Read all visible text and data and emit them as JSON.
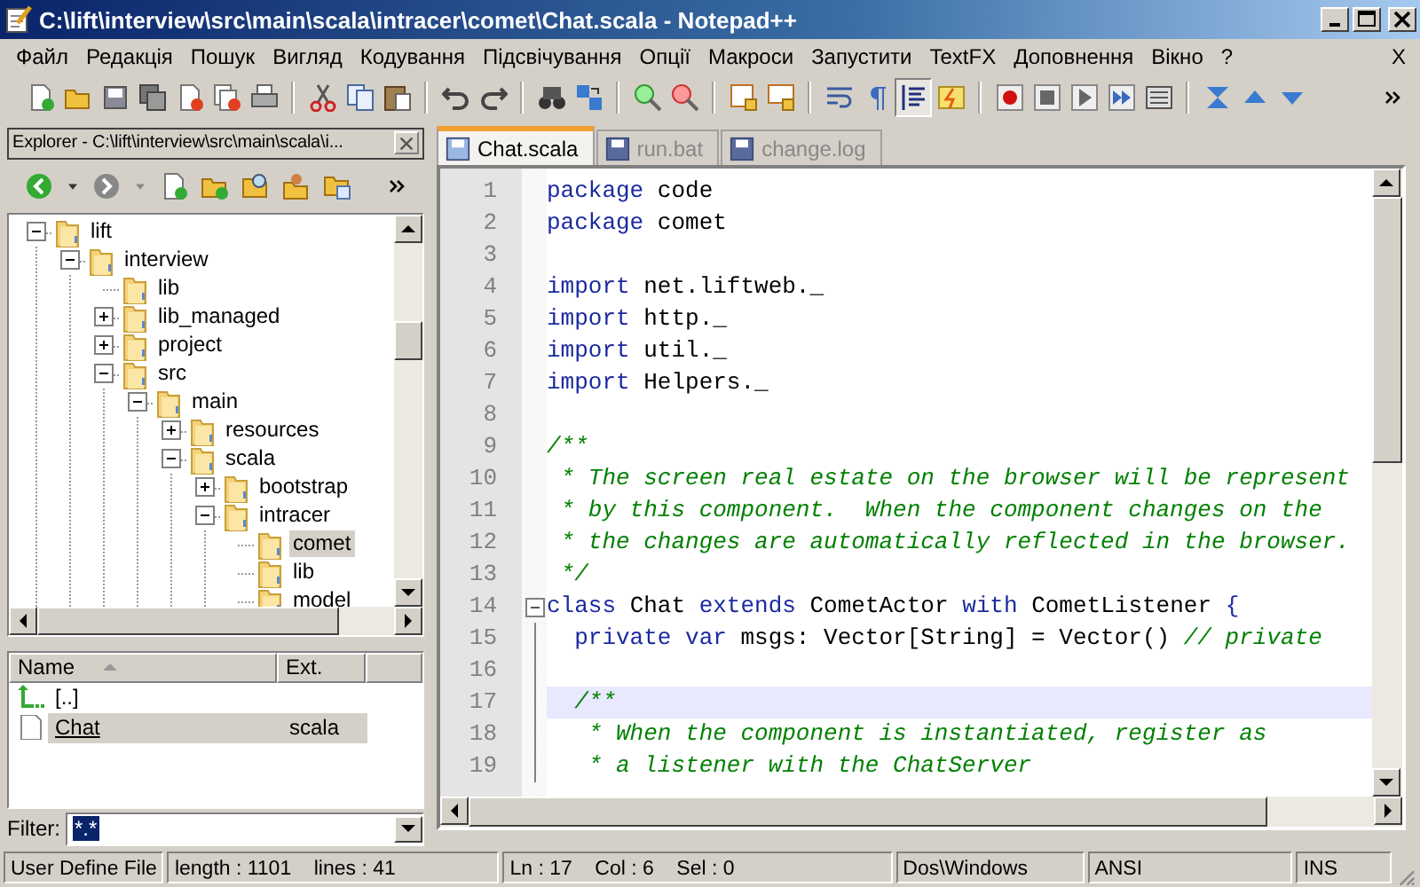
{
  "window": {
    "title": "C:\\lift\\interview\\src\\main\\scala\\intracer\\comet\\Chat.scala - Notepad++"
  },
  "menu": {
    "items": [
      "Файл",
      "Редакція",
      "Пошук",
      "Вигляд",
      "Кодування",
      "Підсвічування",
      "Опції",
      "Макроси",
      "Запустити",
      "TextFX",
      "Доповнення",
      "Вікно",
      "?"
    ],
    "close_doc": "X"
  },
  "toolbar": [
    {
      "kind": "new",
      "pressed": false
    },
    {
      "kind": "open",
      "pressed": false
    },
    {
      "kind": "save",
      "pressed": false
    },
    {
      "kind": "save_all",
      "pressed": false
    },
    {
      "kind": "close",
      "pressed": false
    },
    {
      "kind": "close_all",
      "pressed": false
    },
    {
      "kind": "print",
      "pressed": false
    },
    {
      "kind": "separator"
    },
    {
      "kind": "cut",
      "pressed": false
    },
    {
      "kind": "copy",
      "pressed": false
    },
    {
      "kind": "paste",
      "pressed": false
    },
    {
      "kind": "separator"
    },
    {
      "kind": "undo",
      "pressed": false
    },
    {
      "kind": "redo",
      "pressed": false
    },
    {
      "kind": "separator"
    },
    {
      "kind": "find",
      "pressed": false
    },
    {
      "kind": "replace",
      "pressed": false
    },
    {
      "kind": "separator"
    },
    {
      "kind": "zoom_in",
      "pressed": false
    },
    {
      "kind": "zoom_out",
      "pressed": false
    },
    {
      "kind": "separator"
    },
    {
      "kind": "sync_v",
      "pressed": false
    },
    {
      "kind": "sync_h",
      "pressed": false
    },
    {
      "kind": "separator"
    },
    {
      "kind": "wrap",
      "pressed": false
    },
    {
      "kind": "all_chars",
      "pressed": false
    },
    {
      "kind": "indent_guide",
      "pressed": true
    },
    {
      "kind": "user_lang",
      "pressed": false
    },
    {
      "kind": "separator"
    },
    {
      "kind": "record",
      "pressed": false
    },
    {
      "kind": "stop",
      "pressed": false
    },
    {
      "kind": "play",
      "pressed": false
    },
    {
      "kind": "play_multi",
      "pressed": false
    },
    {
      "kind": "save_macro",
      "pressed": false
    },
    {
      "kind": "separator"
    },
    {
      "kind": "fold",
      "pressed": false
    },
    {
      "kind": "up",
      "pressed": false
    },
    {
      "kind": "down",
      "pressed": false
    }
  ],
  "explorer": {
    "title": "Explorer - C:\\lift\\interview\\src\\main\\scala\\i...",
    "tree": [
      {
        "label": "lift",
        "has_children": true,
        "expanded": true,
        "selected": false,
        "children": [
          {
            "label": "interview",
            "has_children": true,
            "expanded": true,
            "selected": false,
            "children": [
              {
                "label": "lib",
                "has_children": false,
                "expanded": false,
                "selected": false
              },
              {
                "label": "lib_managed",
                "has_children": true,
                "expanded": false,
                "selected": false
              },
              {
                "label": "project",
                "has_children": true,
                "expanded": false,
                "selected": false
              },
              {
                "label": "src",
                "has_children": true,
                "expanded": true,
                "selected": false,
                "children": [
                  {
                    "label": "main",
                    "has_children": true,
                    "expanded": true,
                    "selected": false,
                    "children": [
                      {
                        "label": "resources",
                        "has_children": true,
                        "expanded": false,
                        "selected": false
                      },
                      {
                        "label": "scala",
                        "has_children": true,
                        "expanded": true,
                        "selected": false,
                        "children": [
                          {
                            "label": "bootstrap",
                            "has_children": true,
                            "expanded": false,
                            "selected": false
                          },
                          {
                            "label": "intracer",
                            "has_children": true,
                            "expanded": true,
                            "selected": false,
                            "children": [
                              {
                                "label": "comet",
                                "has_children": false,
                                "expanded": false,
                                "selected": true
                              },
                              {
                                "label": "lib",
                                "has_children": false,
                                "expanded": false,
                                "selected": false
                              },
                              {
                                "label": "model",
                                "has_children": false,
                                "expanded": false,
                                "selected": false
                              }
                            ]
                          }
                        ]
                      }
                    ]
                  }
                ]
              }
            ]
          }
        ]
      }
    ],
    "file_list": {
      "columns": [
        "Name",
        "Ext."
      ],
      "rows": [
        {
          "kind": "parent",
          "name": "[..]",
          "selected": false
        },
        {
          "kind": "file",
          "name": "Chat",
          "ext": "scala",
          "selected": true
        }
      ]
    },
    "filter": {
      "label": "Filter:",
      "value": "*.*"
    }
  },
  "tabs": [
    {
      "label": "Chat.scala",
      "selected": true
    },
    {
      "label": "run.bat",
      "selected": false
    },
    {
      "label": "change.log",
      "selected": false
    }
  ],
  "editor": {
    "lines": [
      {
        "number": "1",
        "current": false,
        "fold_start": false,
        "in_fold": false,
        "tokens": [
          {
            "kind": "keyword",
            "text": "package"
          },
          {
            "kind": "text",
            "text": " code"
          }
        ]
      },
      {
        "number": "2",
        "current": false,
        "fold_start": false,
        "in_fold": false,
        "tokens": [
          {
            "kind": "keyword",
            "text": "package"
          },
          {
            "kind": "text",
            "text": " comet"
          }
        ]
      },
      {
        "number": "3",
        "current": false,
        "fold_start": false,
        "in_fold": false
      },
      {
        "number": "4",
        "current": false,
        "fold_start": false,
        "in_fold": false,
        "tokens": [
          {
            "kind": "keyword",
            "text": "import"
          },
          {
            "kind": "text",
            "text": " net.liftweb._"
          }
        ]
      },
      {
        "number": "5",
        "current": false,
        "fold_start": false,
        "in_fold": false,
        "tokens": [
          {
            "kind": "keyword",
            "text": "import"
          },
          {
            "kind": "text",
            "text": " http._"
          }
        ]
      },
      {
        "number": "6",
        "current": false,
        "fold_start": false,
        "in_fold": false,
        "tokens": [
          {
            "kind": "keyword",
            "text": "import"
          },
          {
            "kind": "text",
            "text": " util._"
          }
        ]
      },
      {
        "number": "7",
        "current": false,
        "fold_start": false,
        "in_fold": false,
        "tokens": [
          {
            "kind": "keyword",
            "text": "import"
          },
          {
            "kind": "text",
            "text": " Helpers._"
          }
        ]
      },
      {
        "number": "8",
        "current": false,
        "fold_start": false,
        "in_fold": false
      },
      {
        "number": "9",
        "current": false,
        "fold_start": false,
        "in_fold": false,
        "tokens": [
          {
            "kind": "comment",
            "text": "/**"
          }
        ]
      },
      {
        "number": "10",
        "current": false,
        "fold_start": false,
        "in_fold": false,
        "tokens": [
          {
            "kind": "comment",
            "text": " * The screen real estate on the browser will be represent"
          }
        ]
      },
      {
        "number": "11",
        "current": false,
        "fold_start": false,
        "in_fold": false,
        "tokens": [
          {
            "kind": "comment",
            "text": " * by this component.  When the component changes on the"
          }
        ]
      },
      {
        "number": "12",
        "current": false,
        "fold_start": false,
        "in_fold": false,
        "tokens": [
          {
            "kind": "comment",
            "text": " * the changes are automatically reflected in the browser."
          }
        ]
      },
      {
        "number": "13",
        "current": false,
        "fold_start": false,
        "in_fold": false,
        "tokens": [
          {
            "kind": "comment",
            "text": " */"
          }
        ]
      },
      {
        "number": "14",
        "current": false,
        "fold_start": true,
        "in_fold": false,
        "tokens": [
          {
            "kind": "keyword",
            "text": "class"
          },
          {
            "kind": "text",
            "text": " Chat "
          },
          {
            "kind": "keyword",
            "text": "extends"
          },
          {
            "kind": "text",
            "text": " CometActor "
          },
          {
            "kind": "keyword",
            "text": "with"
          },
          {
            "kind": "text",
            "text": " CometListener "
          },
          {
            "kind": "keyword",
            "text": "{"
          }
        ]
      },
      {
        "number": "15",
        "current": false,
        "fold_start": false,
        "in_fold": true,
        "tokens": [
          {
            "kind": "keyword",
            "text": "  private var"
          },
          {
            "kind": "text",
            "text": " msgs: Vector[String] = Vector() "
          },
          {
            "kind": "comment",
            "text": "// private"
          }
        ]
      },
      {
        "number": "16",
        "current": false,
        "fold_start": false,
        "in_fold": true
      },
      {
        "number": "17",
        "current": true,
        "fold_start": false,
        "in_fold": true,
        "tokens": [
          {
            "kind": "comment",
            "text": "  /**"
          }
        ]
      },
      {
        "number": "18",
        "current": false,
        "fold_start": false,
        "in_fold": true,
        "tokens": [
          {
            "kind": "comment",
            "text": "   * When the component is instantiated, register as"
          }
        ]
      },
      {
        "number": "19",
        "current": false,
        "fold_start": false,
        "in_fold": true,
        "tokens": [
          {
            "kind": "comment",
            "text": "   * a listener with the ChatServer"
          }
        ]
      }
    ]
  },
  "status_bar": [
    "User Define File",
    "length : 1101    lines : 41",
    "Ln : 17    Col : 6    Sel : 0",
    "Dos\\Windows",
    "ANSI",
    "INS"
  ]
}
